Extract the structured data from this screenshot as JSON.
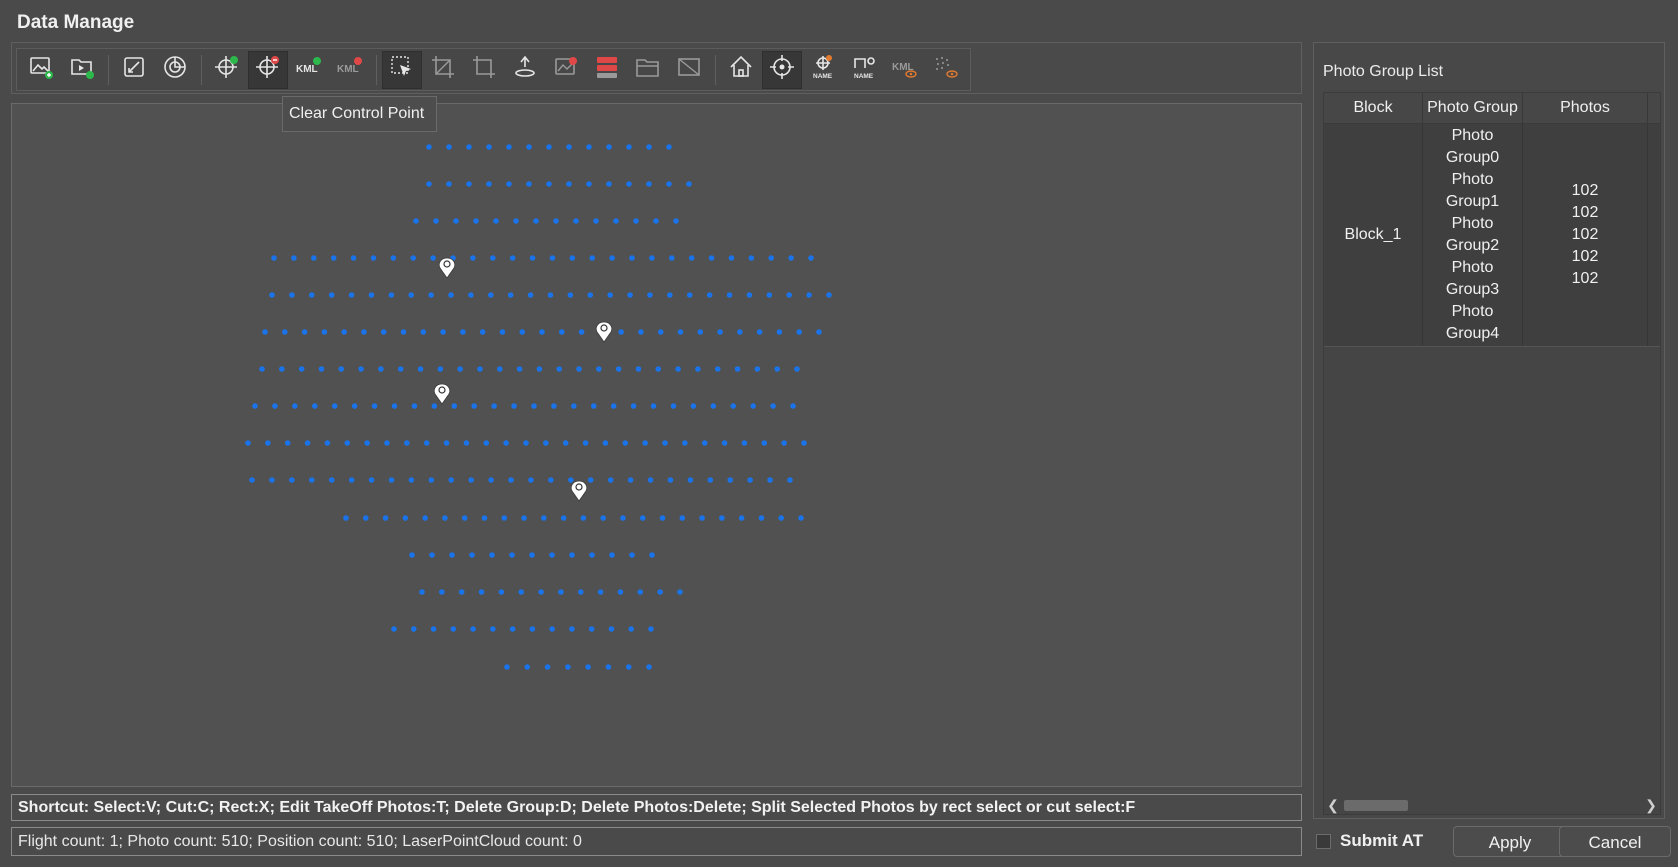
{
  "window": {
    "title": "Data Manage"
  },
  "toolbar": {
    "buttons": [
      {
        "icon": "add-image-icon",
        "group": 1
      },
      {
        "icon": "import-video-icon",
        "group": 1
      },
      {
        "icon": "edit-area-icon",
        "group": 2
      },
      {
        "icon": "pie-chart-icon",
        "group": 2
      },
      {
        "icon": "add-control-point-icon",
        "group": 3
      },
      {
        "icon": "clear-control-point-icon",
        "group": 3,
        "active": true
      },
      {
        "icon": "import-kml-icon",
        "group": 3,
        "label": "KML"
      },
      {
        "icon": "remove-kml-icon",
        "group": 3,
        "label": "KML"
      },
      {
        "icon": "select-cursor-icon",
        "group": 4,
        "active": true
      },
      {
        "icon": "crop-icon",
        "group": 4
      },
      {
        "icon": "rect-crop-icon",
        "group": 4
      },
      {
        "icon": "takeoff-icon",
        "group": 4
      },
      {
        "icon": "delete-image-icon",
        "group": 4
      },
      {
        "icon": "delete-group-icon",
        "group": 4
      },
      {
        "icon": "open-folder-icon",
        "group": 4
      },
      {
        "icon": "hide-images-icon",
        "group": 4
      },
      {
        "icon": "home-icon",
        "group": 5
      },
      {
        "icon": "target-icon",
        "group": 5,
        "active": true
      },
      {
        "icon": "show-control-name-icon",
        "group": 5,
        "label": "NAME"
      },
      {
        "icon": "show-photo-name-icon",
        "group": 5,
        "label": "NAME"
      },
      {
        "icon": "kml-visibility-icon",
        "group": 5,
        "label": "KML"
      },
      {
        "icon": "pointcloud-visibility-icon",
        "group": 5
      }
    ],
    "tooltip": "Clear Control Point"
  },
  "map": {
    "point_color": "#1a73e8",
    "control_points": 4
  },
  "shortcut_text": "Shortcut: Select:V; Cut:C; Rect:X; Edit TakeOff Photos:T; Delete Group:D; Delete Photos:Delete; Split Selected Photos by rect select or cut select:F",
  "status_text": "Flight count: 1; Photo count: 510; Position count: 510; LaserPointCloud count: 0",
  "photo_group_panel": {
    "title": "Photo Group List",
    "columns": [
      "Block",
      "Photo Group",
      "Photos"
    ],
    "rows": [
      {
        "block": "Block_1",
        "groups": [
          "Photo Group0",
          "Photo Group1",
          "Photo Group2",
          "Photo Group3",
          "Photo Group4"
        ],
        "photos": [
          "102",
          "102",
          "102",
          "102",
          "102"
        ]
      }
    ]
  },
  "footer": {
    "submit_at_label": "Submit AT",
    "submit_at_checked": false,
    "apply_label": "Apply",
    "cancel_label": "Cancel"
  }
}
